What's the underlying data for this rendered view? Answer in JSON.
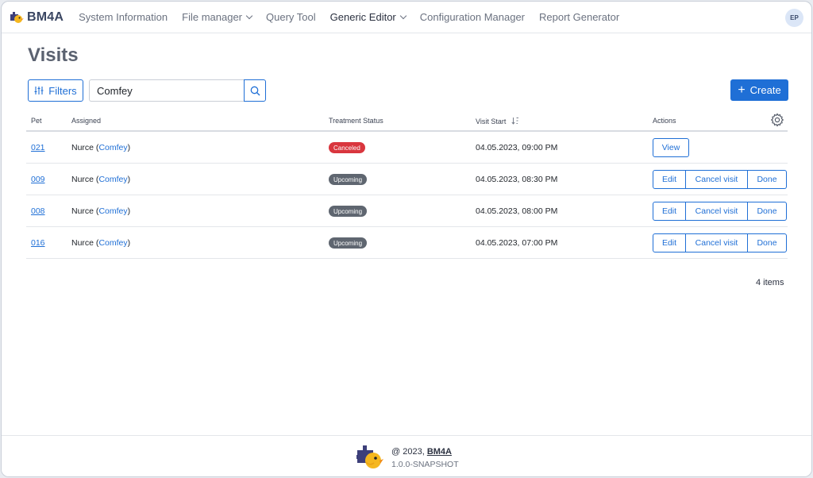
{
  "app": {
    "name": "BM4A",
    "nav": [
      {
        "label": "System Information",
        "dropdown": false,
        "active": false
      },
      {
        "label": "File manager",
        "dropdown": true,
        "active": false
      },
      {
        "label": "Query Tool",
        "dropdown": false,
        "active": false
      },
      {
        "label": "Generic Editor",
        "dropdown": true,
        "active": true
      },
      {
        "label": "Configuration Manager",
        "dropdown": false,
        "active": false
      },
      {
        "label": "Report Generator",
        "dropdown": false,
        "active": false
      }
    ],
    "user_initials": "EP"
  },
  "page": {
    "title": "Visits",
    "filters_label": "Filters",
    "search": {
      "value": "Comfey",
      "placeholder": ""
    },
    "create_label": "Create"
  },
  "table": {
    "columns": [
      "Pet",
      "Assigned",
      "Treatment Status",
      "Visit Start",
      "Actions"
    ],
    "rows": [
      {
        "pet": "021",
        "assigned_prefix": "Nurce (",
        "assigned_link": "Comfey",
        "assigned_suffix": ")",
        "status": "Canceled",
        "status_color": "#d9363e",
        "visit_start": "04.05.2023, 09:00 PM",
        "actions": [
          "View"
        ]
      },
      {
        "pet": "009",
        "assigned_prefix": "Nurce (",
        "assigned_link": "Comfey",
        "assigned_suffix": ")",
        "status": "Upcoming",
        "status_color": "#5f6670",
        "visit_start": "04.05.2023, 08:30 PM",
        "actions": [
          "Edit",
          "Cancel visit",
          "Done"
        ]
      },
      {
        "pet": "008",
        "assigned_prefix": "Nurce (",
        "assigned_link": "Comfey",
        "assigned_suffix": ")",
        "status": "Upcoming",
        "status_color": "#5f6670",
        "visit_start": "04.05.2023, 08:00 PM",
        "actions": [
          "Edit",
          "Cancel visit",
          "Done"
        ]
      },
      {
        "pet": "016",
        "assigned_prefix": "Nurce (",
        "assigned_link": "Comfey",
        "assigned_suffix": ")",
        "status": "Upcoming",
        "status_color": "#5f6670",
        "visit_start": "04.05.2023, 07:00 PM",
        "actions": [
          "Edit",
          "Cancel visit",
          "Done"
        ]
      }
    ],
    "items_count": "4 items"
  },
  "footer": {
    "copyright_prefix": "@ 2023, ",
    "copyright_link": "BM4A",
    "version": "1.0.0-SNAPSHOT"
  },
  "colors": {
    "accent": "#1f6fd6",
    "canceled": "#d9363e",
    "upcoming": "#5f6670"
  }
}
